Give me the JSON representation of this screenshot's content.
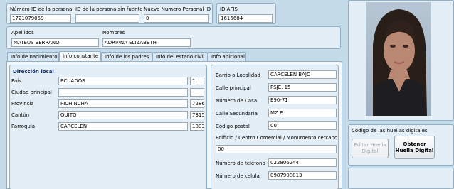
{
  "id_section": {
    "numero_id_label": "Número ID de la persona",
    "numero_id_value": "1721079059",
    "id_sin_fuente_label": "ID de la persona sin fuente",
    "id_sin_fuente_value": "",
    "nuevo_numero_label": "Nuevo Numero Personal ID",
    "nuevo_numero_value": "0",
    "afis_label": "ID AFIS",
    "afis_value": "1616684"
  },
  "name_section": {
    "apellidos_label": "Apellidos",
    "apellidos_value": "MATEUS SERRANO",
    "nombres_label": "Nombres",
    "nombres_value": "ADRIANA ELIZABETH"
  },
  "tabs": [
    {
      "label": "Info de nacimiento"
    },
    {
      "label": "Info constante"
    },
    {
      "label": "Info de los padres"
    },
    {
      "label": "Info del estado civil"
    },
    {
      "label": "Info adicional"
    }
  ],
  "direccion": {
    "title": "Dirección local",
    "pais_label": "País",
    "pais_value": "ECUADOR",
    "pais_code": "1",
    "ciudad_label": "Ciudad principal",
    "ciudad_value": "",
    "ciudad_code": "",
    "provincia_label": "Provincia",
    "provincia_value": "PICHINCHA",
    "provincia_code": "7286",
    "canton_label": "Cantón",
    "canton_value": "QUITO",
    "canton_code": "7315",
    "parroquia_label": "Parroquia",
    "parroquia_value": "CARCELEN",
    "parroquia_code": "1803"
  },
  "right_fields": {
    "barrio_label": "Barrio o Localidad",
    "barrio_value": "CARCELEN BAJO",
    "calle_principal_label": "Calle principal",
    "calle_principal_value": "PSJE. 15",
    "numero_casa_label": "Número de Casa",
    "numero_casa_value": "E90-71",
    "calle_secundaria_label": "Calle Secundaria",
    "calle_secundaria_value": "MZ.E",
    "codigo_postal_label": "Código postal",
    "codigo_postal_value": "00",
    "edificio_label": "Edificio / Centro Comercial / Monumento cercano",
    "edificio_value": "00",
    "telefono_label": "Número de teléfono",
    "telefono_value": "022806244",
    "celular_label": "Número de celular",
    "celular_value": "0987908813"
  },
  "fingerprint": {
    "title": "Código de las huellas digitales",
    "edit_button": "Editar Huella Digital",
    "obtain_button": "Obtener Huella Digital"
  }
}
